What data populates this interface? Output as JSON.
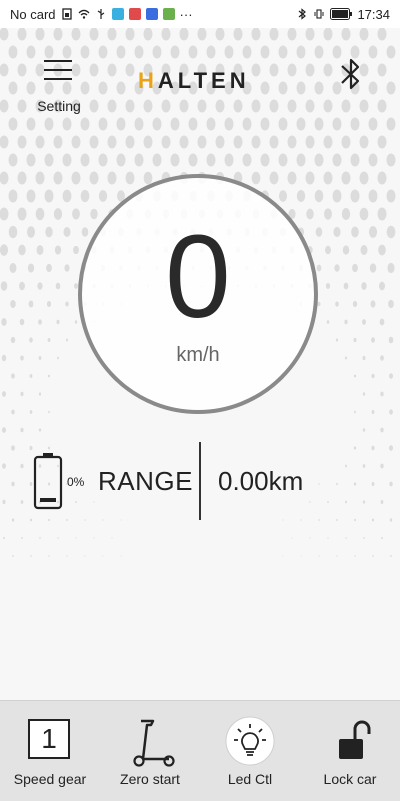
{
  "status_bar": {
    "carrier": "No card",
    "time": "17:34",
    "more": "···"
  },
  "header": {
    "menu_label": "Setting",
    "logo_accent": "H",
    "logo_rest": "ALTEN",
    "menu_icon": "hamburger-menu-icon",
    "bluetooth_icon": "bluetooth-icon"
  },
  "speedometer": {
    "speed": "0",
    "unit": "km/h"
  },
  "range": {
    "battery_percent": "0%",
    "battery_level": 0,
    "label": "RANGE",
    "value": "0.00km"
  },
  "bottom_tabs": [
    {
      "label": "Speed gear",
      "value": "1",
      "icon": "speed-gear-icon"
    },
    {
      "label": "Zero start",
      "icon": "scooter-icon"
    },
    {
      "label": "Led Ctl",
      "icon": "light-bulb-icon"
    },
    {
      "label": "Lock car",
      "icon": "unlock-icon"
    }
  ],
  "colors": {
    "accent": "#e8a317",
    "ring": "#8a8a8a",
    "bottom_bar": "#e3e3e3"
  }
}
